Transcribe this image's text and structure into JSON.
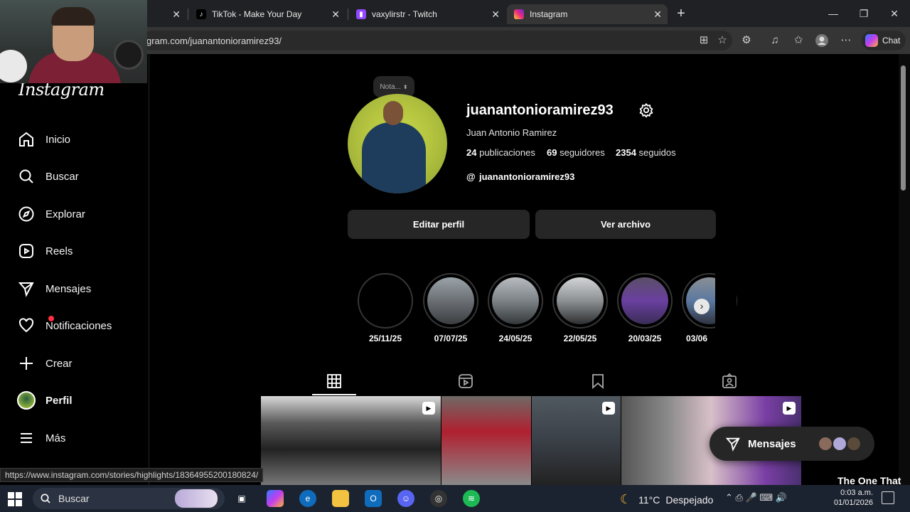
{
  "browser": {
    "tabs": [
      {
        "title": "",
        "favicon": "unknown"
      },
      {
        "title": "TikTok - Make Your Day",
        "favicon": "tiktok-icon"
      },
      {
        "title": "vaxylirstr - Twitch",
        "favicon": "twitch-icon"
      },
      {
        "title": "Instagram",
        "favicon": "instagram-icon",
        "active": true
      }
    ],
    "url": "gram.com/juanantonioramirez93/",
    "chat_label": "Chat"
  },
  "sidebar": {
    "logo": "Instagram",
    "items": [
      {
        "label": "Inicio",
        "icon": "home-icon"
      },
      {
        "label": "Buscar",
        "icon": "search-icon"
      },
      {
        "label": "Explorar",
        "icon": "compass-icon"
      },
      {
        "label": "Reels",
        "icon": "reels-icon"
      },
      {
        "label": "Mensajes",
        "icon": "send-icon"
      },
      {
        "label": "Notificaciones",
        "icon": "heart-icon"
      },
      {
        "label": "Crear",
        "icon": "plus-icon"
      },
      {
        "label": "Perfil",
        "icon": "avatar"
      },
      {
        "label": "Más",
        "icon": "menu-icon"
      }
    ]
  },
  "profile": {
    "note": "Nota...",
    "username": "juanantonioramirez93",
    "full_name": "Juan Antonio Ramirez",
    "posts_count": "24",
    "posts_label": "publicaciones",
    "followers_count": "69",
    "followers_label": "seguidores",
    "following_count": "2354",
    "following_label": "seguidos",
    "threads_handle": "juanantonioramirez93",
    "edit_button": "Editar perfil",
    "archive_button": "Ver archivo"
  },
  "highlights": [
    {
      "label": "25/11/25"
    },
    {
      "label": "07/07/25"
    },
    {
      "label": "24/05/25"
    },
    {
      "label": "22/05/25"
    },
    {
      "label": "20/03/25"
    },
    {
      "label": "03/06"
    }
  ],
  "profile_tabs": [
    "posts-grid-icon",
    "reels-tab-icon",
    "saved-icon",
    "tagged-icon"
  ],
  "messages_pill": {
    "label": "Mensajes"
  },
  "status_link": "https://www.instagram.com/stories/highlights/18364955200180824/",
  "taskbar": {
    "search_placeholder": "Buscar",
    "weather_temp": "11°C",
    "weather_desc": "Despejado",
    "time": "0:03 a.m.",
    "date": "01/01/2026"
  },
  "overlay_ticker": "The One That G"
}
